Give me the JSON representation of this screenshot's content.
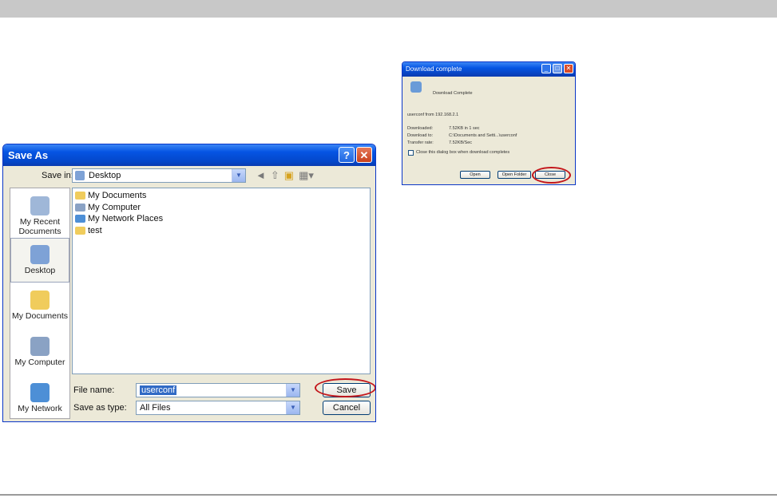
{
  "save_as": {
    "title": "Save As",
    "help_glyph": "?",
    "close_glyph": "✕",
    "save_in_label": "Save in:",
    "save_in_value": "Desktop",
    "places": [
      "My Recent Documents",
      "Desktop",
      "My Documents",
      "My Computer",
      "My Network"
    ],
    "files": [
      "My Documents",
      "My Computer",
      "My Network Places",
      "test"
    ],
    "file_name_label": "File name:",
    "file_name_value": "userconf",
    "save_as_type_label": "Save as type:",
    "save_as_type_value": "All Files",
    "save_button": "Save",
    "cancel_button": "Cancel",
    "colors": {
      "titlebar": "#0554e3",
      "highlight": "#c3161b"
    }
  },
  "download": {
    "title": "Download complete",
    "heading": "Download Complete",
    "source": "userconf from 192.168.2.1",
    "downloaded_label": "Downloaded:",
    "downloaded_value": "7.52KB in 1 sec",
    "download_to_label": "Download to:",
    "download_to_value": "C:\\Documents and Setti...\\userconf",
    "transfer_rate_label": "Transfer rate:",
    "transfer_rate_value": "7.52KB/Sec",
    "close_checkbox": "Close this dialog box when download completes",
    "open_button": "Open",
    "open_folder_button": "Open Folder",
    "close_button": "Close"
  }
}
